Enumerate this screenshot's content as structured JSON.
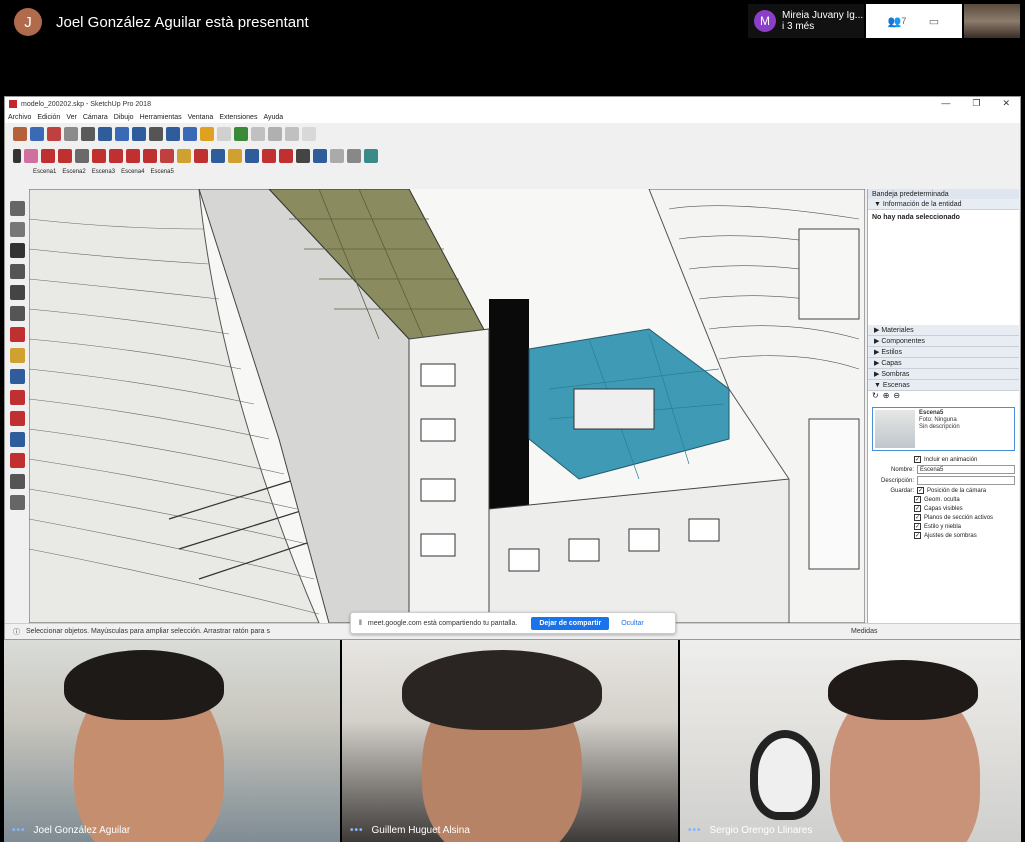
{
  "meet": {
    "presenter_initial": "J",
    "presenter_text": "Joel González Aguilar està presentant",
    "pinned_initial": "M",
    "pinned_name": "Mireia Juvany Ig...",
    "pinned_more": "i 3 més",
    "people_count": "7",
    "share_banner_text": "meet.google.com està compartiendo tu pantalla.",
    "share_stop_label": "Dejar de compartir",
    "share_hide_label": "Ocultar"
  },
  "sketchup": {
    "title": "modelo_200202.skp - SketchUp Pro 2018",
    "menu": [
      "Archivo",
      "Edición",
      "Ver",
      "Cámara",
      "Dibujo",
      "Herramientas",
      "Ventana",
      "Extensiones",
      "Ayuda"
    ],
    "scene_tabs": [
      "Escena1",
      "Escena2",
      "Escena3",
      "Escena4",
      "Escena5"
    ],
    "status_text": "Seleccionar objetos. Mayúsculas para ampliar selección. Arrastrar ratón para s",
    "status_measures": "Medidas",
    "tray": {
      "header": "Bandeja predeterminada",
      "entity_info": "Información de la entidad",
      "no_selection": "No hay nada seleccionado",
      "sections": [
        "Materiales",
        "Componentes",
        "Estilos",
        "Capas",
        "Sombras",
        "Escenas"
      ],
      "scene_name": "Escena5",
      "scene_meta": "Foto: Ninguna",
      "scene_desc": "Sin descripción",
      "include_animation": "Incluir en animación",
      "name_label": "Nombre:",
      "name_value": "Escena5",
      "desc_label": "Descripción:",
      "save_label": "Guardar:",
      "save_options": [
        "Posición de la cámara",
        "Geom. oculta",
        "Capas visibles",
        "Planos de sección activos",
        "Estilo y niebla",
        "Ajustes de sombras"
      ]
    }
  },
  "participants": [
    {
      "name": "Joel González Aguilar"
    },
    {
      "name": "Guillem Huguet Alsina"
    },
    {
      "name": "Sergio Orengo Llinares"
    }
  ]
}
